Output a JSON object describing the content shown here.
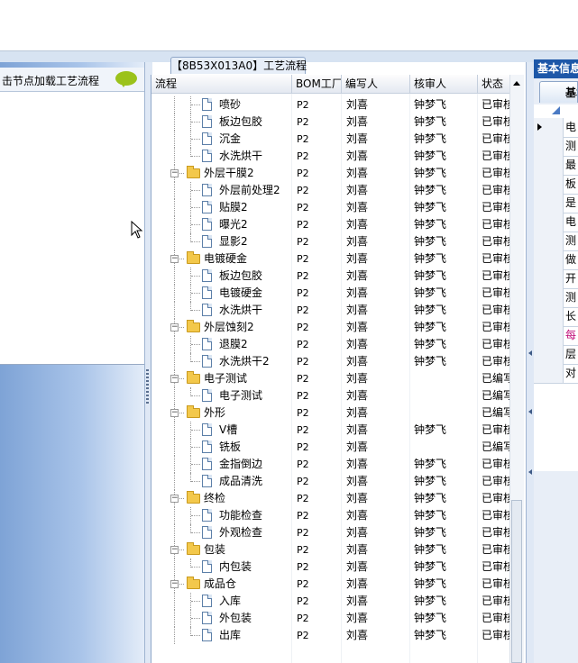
{
  "left_panel": {
    "hint": "击节点加载工艺流程"
  },
  "center": {
    "title": "【8B53X013A0】工艺流程",
    "columns": [
      "流程",
      "BOM工厂",
      "编写人",
      "核审人",
      "状态"
    ],
    "rows": [
      {
        "name": "喷砂",
        "level": 1,
        "folder": false,
        "bom": "P2",
        "writer": "刘喜",
        "reviewer": "钟梦飞",
        "status": "已审核"
      },
      {
        "name": "板边包胶",
        "level": 1,
        "folder": false,
        "bom": "P2",
        "writer": "刘喜",
        "reviewer": "钟梦飞",
        "status": "已审核"
      },
      {
        "name": "沉金",
        "level": 1,
        "folder": false,
        "bom": "P2",
        "writer": "刘喜",
        "reviewer": "钟梦飞",
        "status": "已审核"
      },
      {
        "name": "水洗烘干",
        "level": 1,
        "folder": false,
        "bom": "P2",
        "writer": "刘喜",
        "reviewer": "钟梦飞",
        "status": "已审核"
      },
      {
        "name": "外层干膜2",
        "level": 0,
        "folder": true,
        "bom": "P2",
        "writer": "刘喜",
        "reviewer": "钟梦飞",
        "status": "已审核"
      },
      {
        "name": "外层前处理2",
        "level": 1,
        "folder": false,
        "bom": "P2",
        "writer": "刘喜",
        "reviewer": "钟梦飞",
        "status": "已审核"
      },
      {
        "name": "贴膜2",
        "level": 1,
        "folder": false,
        "bom": "P2",
        "writer": "刘喜",
        "reviewer": "钟梦飞",
        "status": "已审核"
      },
      {
        "name": "曝光2",
        "level": 1,
        "folder": false,
        "bom": "P2",
        "writer": "刘喜",
        "reviewer": "钟梦飞",
        "status": "已审核"
      },
      {
        "name": "显影2",
        "level": 1,
        "folder": false,
        "bom": "P2",
        "writer": "刘喜",
        "reviewer": "钟梦飞",
        "status": "已审核"
      },
      {
        "name": "电镀硬金",
        "level": 0,
        "folder": true,
        "bom": "P2",
        "writer": "刘喜",
        "reviewer": "钟梦飞",
        "status": "已审核"
      },
      {
        "name": "板边包胶",
        "level": 1,
        "folder": false,
        "bom": "P2",
        "writer": "刘喜",
        "reviewer": "钟梦飞",
        "status": "已审核"
      },
      {
        "name": "电镀硬金",
        "level": 1,
        "folder": false,
        "bom": "P2",
        "writer": "刘喜",
        "reviewer": "钟梦飞",
        "status": "已审核"
      },
      {
        "name": "水洗烘干",
        "level": 1,
        "folder": false,
        "bom": "P2",
        "writer": "刘喜",
        "reviewer": "钟梦飞",
        "status": "已审核"
      },
      {
        "name": "外层蚀刻2",
        "level": 0,
        "folder": true,
        "bom": "P2",
        "writer": "刘喜",
        "reviewer": "钟梦飞",
        "status": "已审核"
      },
      {
        "name": "退膜2",
        "level": 1,
        "folder": false,
        "bom": "P2",
        "writer": "刘喜",
        "reviewer": "钟梦飞",
        "status": "已审核"
      },
      {
        "name": "水洗烘干2",
        "level": 1,
        "folder": false,
        "bom": "P2",
        "writer": "刘喜",
        "reviewer": "钟梦飞",
        "status": "已审核"
      },
      {
        "name": "电子测试",
        "level": 0,
        "folder": true,
        "bom": "P2",
        "writer": "刘喜",
        "reviewer": "",
        "status": "已编写"
      },
      {
        "name": "电子测试",
        "level": 1,
        "folder": false,
        "bom": "P2",
        "writer": "刘喜",
        "reviewer": "",
        "status": "已编写"
      },
      {
        "name": "外形",
        "level": 0,
        "folder": true,
        "bom": "P2",
        "writer": "刘喜",
        "reviewer": "",
        "status": "已编写"
      },
      {
        "name": "V槽",
        "level": 1,
        "folder": false,
        "bom": "P2",
        "writer": "刘喜",
        "reviewer": "钟梦飞",
        "status": "已审核"
      },
      {
        "name": "铣板",
        "level": 1,
        "folder": false,
        "bom": "P2",
        "writer": "刘喜",
        "reviewer": "",
        "status": "已编写"
      },
      {
        "name": "金指倒边",
        "level": 1,
        "folder": false,
        "bom": "P2",
        "writer": "刘喜",
        "reviewer": "钟梦飞",
        "status": "已审核"
      },
      {
        "name": "成品清洗",
        "level": 1,
        "folder": false,
        "bom": "P2",
        "writer": "刘喜",
        "reviewer": "钟梦飞",
        "status": "已审核"
      },
      {
        "name": "终检",
        "level": 0,
        "folder": true,
        "bom": "P2",
        "writer": "刘喜",
        "reviewer": "钟梦飞",
        "status": "已审核"
      },
      {
        "name": "功能检查",
        "level": 1,
        "folder": false,
        "bom": "P2",
        "writer": "刘喜",
        "reviewer": "钟梦飞",
        "status": "已审核"
      },
      {
        "name": "外观检查",
        "level": 1,
        "folder": false,
        "bom": "P2",
        "writer": "刘喜",
        "reviewer": "钟梦飞",
        "status": "已审核"
      },
      {
        "name": "包装",
        "level": 0,
        "folder": true,
        "bom": "P2",
        "writer": "刘喜",
        "reviewer": "钟梦飞",
        "status": "已审核"
      },
      {
        "name": "内包装",
        "level": 1,
        "folder": false,
        "bom": "P2",
        "writer": "刘喜",
        "reviewer": "钟梦飞",
        "status": "已审核"
      },
      {
        "name": "成品仓",
        "level": 0,
        "folder": true,
        "bom": "P2",
        "writer": "刘喜",
        "reviewer": "钟梦飞",
        "status": "已审核"
      },
      {
        "name": "入库",
        "level": 1,
        "folder": false,
        "bom": "P2",
        "writer": "刘喜",
        "reviewer": "钟梦飞",
        "status": "已审核"
      },
      {
        "name": "外包装",
        "level": 1,
        "folder": false,
        "bom": "P2",
        "writer": "刘喜",
        "reviewer": "钟梦飞",
        "status": "已审核"
      },
      {
        "name": "出库",
        "level": 1,
        "folder": false,
        "bom": "P2",
        "writer": "刘喜",
        "reviewer": "钟梦飞",
        "status": "已审核"
      }
    ]
  },
  "right_panel": {
    "title": "基本信息",
    "tab": "基本",
    "rows": [
      {
        "label": "电",
        "color": "#000000",
        "current": true
      },
      {
        "label": "测",
        "color": "#000000",
        "current": false
      },
      {
        "label": "最",
        "color": "#000000",
        "current": false
      },
      {
        "label": "板",
        "color": "#000000",
        "current": false
      },
      {
        "label": "是",
        "color": "#000000",
        "current": false
      },
      {
        "label": "电",
        "color": "#000000",
        "current": false
      },
      {
        "label": "测",
        "color": "#000000",
        "current": false
      },
      {
        "label": "做",
        "color": "#000000",
        "current": false
      },
      {
        "label": "开",
        "color": "#000000",
        "current": false
      },
      {
        "label": "测",
        "color": "#000000",
        "current": false
      },
      {
        "label": "长",
        "color": "#000000",
        "current": false
      },
      {
        "label": "每",
        "color": "#c0107a",
        "current": false
      },
      {
        "label": "层",
        "color": "#000000",
        "current": false
      },
      {
        "label": "对",
        "color": "#000000",
        "current": false
      }
    ]
  },
  "icons": {
    "doc": "document-icon",
    "folder": "folder-icon",
    "cursor": "mouse-cursor-icon",
    "comment": "speech-bubble-icon"
  }
}
